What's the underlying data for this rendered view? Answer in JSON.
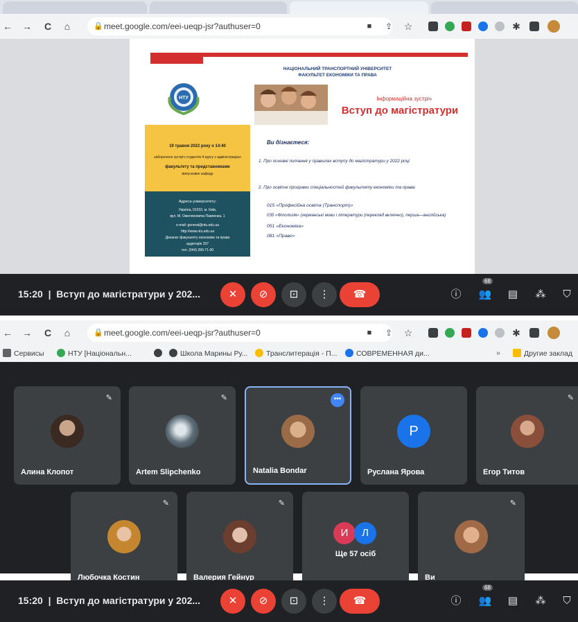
{
  "screenshot1": {
    "url": "meet.google.com/eei-ueqp-jsr?authuser=0",
    "slide": {
      "university_line1": "НАЦІОНАЛЬНИЙ ТРАНСПОРТНИЙ УНІВЕРСИТЕТ",
      "university_line2": "ФАКУЛЬТЕТ ЕКОНОМІКИ ТА ПРАВА",
      "emblem_text": "НТУ",
      "subtitle": "Інформаційна зустріч",
      "title": "Вступ до магістратури",
      "yellow_box_line1": "19 травня 2022 року о 14:40",
      "yellow_box_line2": "заборонено зустріч студентів 4 курсу з адміністрацією",
      "yellow_box_line3": "факультету та представниками",
      "yellow_box_line4": "випускових кафедр",
      "address_heading": "Адреса університету:",
      "address_line1": "Україна, 01010, м. Київ,",
      "address_line2": "вул. М. Омеляновича-Павленка, 1",
      "address_line3": "e-mail: general@ntu.edu.ua",
      "address_line4": "http://www.ntu.edu.ua",
      "address_line5": "Деканат факультету економіки та права",
      "address_line6": "аудиторія 207",
      "address_line7": "тел. (044) 280-71-00",
      "learn_heading": "Ви дізнаєтеся:",
      "point1": "1. Про основні питання у правилах вступу до магістратури у 2022 році",
      "point2": "2. Про освітні програми спеціальностей факультету економіки та права:",
      "programs": [
        "015 «Професійна освіта (Транспорт)»",
        "035 «Філологія» (германські мови і літератури (переклад включно), перша—англійська)",
        "051 «Економіка»",
        "081 «Право»"
      ]
    },
    "meeting_time": "15:20",
    "meeting_title": "Вступ до магістратури у 202...",
    "participants_badge": "68"
  },
  "screenshot2": {
    "url": "meet.google.com/eei-ueqp-jsr?authuser=0",
    "bookmarks": [
      "Сервисы",
      "НТУ [Національн...",
      "",
      "Школа Марины Ру...",
      "Транслитерація - П...",
      "СОВРЕМЕННАЯ ди...",
      "Другие заклад"
    ],
    "tiles_row1": [
      {
        "name": "Алина Клопот"
      },
      {
        "name": "Artem Slipchenko"
      },
      {
        "name": "Natalia Bondar"
      },
      {
        "name": "Руслана Ярова",
        "initial": "P"
      },
      {
        "name": "Егор Титов"
      }
    ],
    "tiles_row2": [
      {
        "name": "Любочка Костин"
      },
      {
        "name": "Валерия Гейнур"
      },
      {
        "name": "Ще 57 осіб",
        "initials": [
          "И",
          "Л"
        ]
      },
      {
        "name": "Ви"
      }
    ],
    "meeting_time": "15:20",
    "meeting_title": "Вступ до магістратури у 202...",
    "participants_badge": "68"
  },
  "colors": {
    "meet_bg": "#202124",
    "tile_bg": "#3c4043",
    "red_button": "#ea4335",
    "slide_red": "#d32f2f",
    "slide_yellow": "#f6c443",
    "slide_teal": "#1f5260",
    "speaking_border": "#8ab4f8",
    "avatar_blue": "#1a73e8"
  }
}
